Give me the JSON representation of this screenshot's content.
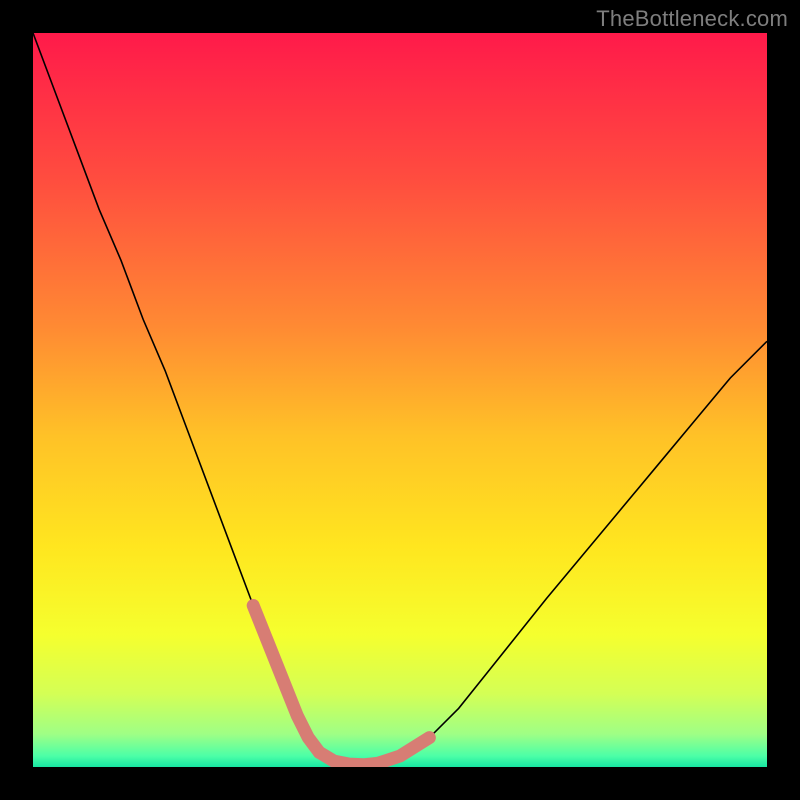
{
  "watermark": "TheBottleneck.com",
  "chart_data": {
    "type": "line",
    "title": "",
    "xlabel": "",
    "ylabel": "",
    "xlim": [
      0,
      100
    ],
    "ylim": [
      0,
      100
    ],
    "grid": false,
    "legend": false,
    "background": {
      "type": "vertical-gradient",
      "stops": [
        {
          "pos": 0.0,
          "color": "#ff1a4a"
        },
        {
          "pos": 0.2,
          "color": "#ff4d3f"
        },
        {
          "pos": 0.4,
          "color": "#ff8a33"
        },
        {
          "pos": 0.55,
          "color": "#ffc227"
        },
        {
          "pos": 0.7,
          "color": "#ffe61f"
        },
        {
          "pos": 0.82,
          "color": "#f5ff2e"
        },
        {
          "pos": 0.9,
          "color": "#d4ff55"
        },
        {
          "pos": 0.955,
          "color": "#9fff85"
        },
        {
          "pos": 0.985,
          "color": "#4cffa7"
        },
        {
          "pos": 1.0,
          "color": "#18e6a2"
        }
      ]
    },
    "series": [
      {
        "name": "curve",
        "color": "#000000",
        "width": 1.6,
        "x": [
          0,
          3,
          6,
          9,
          12,
          15,
          18,
          21,
          24,
          27,
          30,
          32,
          34,
          36,
          37.5,
          39,
          41,
          43,
          45,
          47,
          50,
          54,
          58,
          62,
          66,
          70,
          75,
          80,
          85,
          90,
          95,
          100
        ],
        "y": [
          100,
          92,
          84,
          76,
          69,
          61,
          54,
          46,
          38,
          30,
          22,
          17,
          12,
          7,
          4,
          2,
          0.8,
          0.4,
          0.3,
          0.5,
          1.5,
          4,
          8,
          13,
          18,
          23,
          29,
          35,
          41,
          47,
          53,
          58
        ]
      },
      {
        "name": "highlight-left",
        "color": "#d77d74",
        "width": 13,
        "linecap": "round",
        "x": [
          30,
          32,
          34,
          36,
          37.5,
          39
        ],
        "y": [
          22,
          17,
          12,
          7,
          4,
          2
        ]
      },
      {
        "name": "highlight-bottom",
        "color": "#d77d74",
        "width": 13,
        "linecap": "round",
        "x": [
          39,
          41,
          43,
          45,
          47
        ],
        "y": [
          2,
          0.8,
          0.4,
          0.3,
          0.5
        ]
      },
      {
        "name": "highlight-right",
        "color": "#d77d74",
        "width": 13,
        "linecap": "round",
        "x": [
          47,
          50,
          54
        ],
        "y": [
          0.5,
          1.5,
          4
        ]
      }
    ]
  }
}
